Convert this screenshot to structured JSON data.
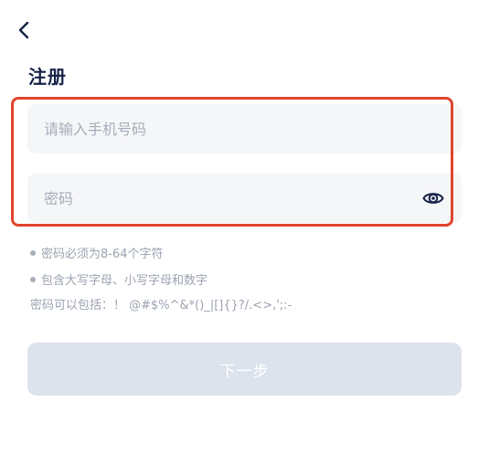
{
  "header": {
    "back_icon": "chevron-left-icon",
    "title": "注册"
  },
  "form": {
    "phone": {
      "placeholder": "请输入手机号码",
      "value": ""
    },
    "password": {
      "placeholder": "密码",
      "value": "",
      "toggle_icon": "eye-icon"
    },
    "highlight_color": "#e0452f"
  },
  "rules": {
    "items": [
      "密码必须为8-64个字符",
      "包含大写字母、小写字母和数字"
    ],
    "allowed_chars": "密码可以包括：！ @#$%^&*()_|[]{}?/.<>,';:-"
  },
  "next_button": {
    "label": "下一步",
    "state": "disabled"
  },
  "colors": {
    "title": "#152146",
    "input_bg": "#f5f6f8",
    "button_disabled_bg": "#dde3ec",
    "rule_text": "#9ba3b0"
  }
}
